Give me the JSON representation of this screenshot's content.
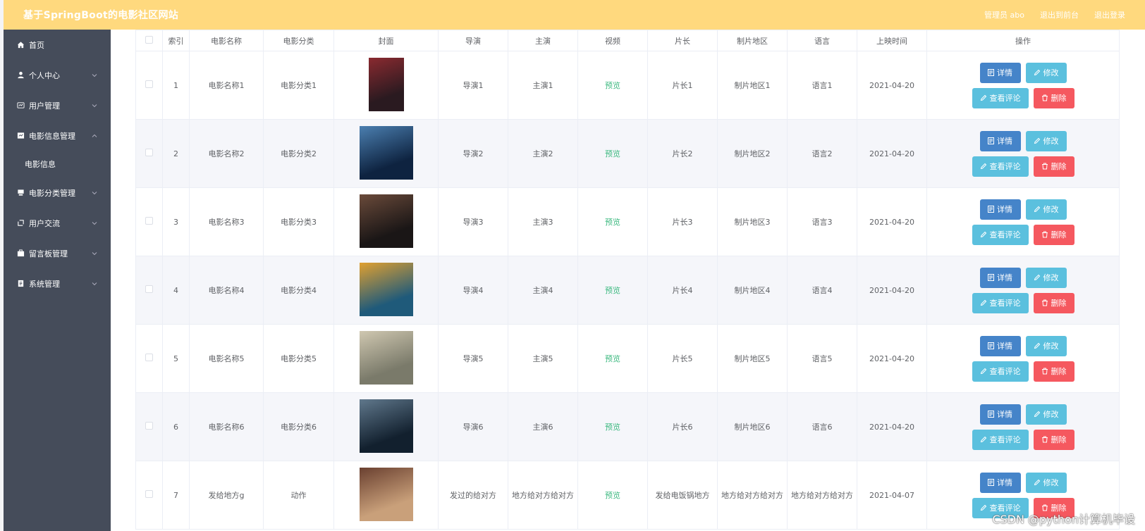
{
  "header": {
    "title": "基于SpringBoot的电影社区网站",
    "admin_label": "管理员 abo",
    "back_label": "退出到前台",
    "logout_label": "退出登录"
  },
  "sidebar": {
    "items": [
      {
        "label": "首页",
        "icon": "home-icon"
      },
      {
        "label": "个人中心",
        "icon": "user-icon"
      },
      {
        "label": "用户管理",
        "icon": "users-icon"
      },
      {
        "label": "电影信息管理",
        "icon": "film-icon"
      },
      {
        "label": "电影信息",
        "sub": true
      },
      {
        "label": "电影分类管理",
        "icon": "category-icon"
      },
      {
        "label": "用户交流",
        "icon": "chat-icon"
      },
      {
        "label": "留言板管理",
        "icon": "message-icon"
      },
      {
        "label": "系统管理",
        "icon": "settings-icon"
      }
    ]
  },
  "table": {
    "headers": [
      "索引",
      "电影名称",
      "电影分类",
      "封面",
      "导演",
      "主演",
      "视频",
      "片长",
      "制片地区",
      "语言",
      "上映时间",
      "操作"
    ],
    "preview_label": "预览",
    "buttons": {
      "detail": "详情",
      "edit": "修改",
      "comment": "查看评论",
      "delete": "删除"
    },
    "rows": [
      {
        "index": "1",
        "name": "电影名称1",
        "category": "电影分类1",
        "director": "导演1",
        "actor": "主演1",
        "length": "片长1",
        "region": "制片地区1",
        "language": "语言1",
        "date": "2021-04-20"
      },
      {
        "index": "2",
        "name": "电影名称2",
        "category": "电影分类2",
        "director": "导演2",
        "actor": "主演2",
        "length": "片长2",
        "region": "制片地区2",
        "language": "语言2",
        "date": "2021-04-20"
      },
      {
        "index": "3",
        "name": "电影名称3",
        "category": "电影分类3",
        "director": "导演3",
        "actor": "主演3",
        "length": "片长3",
        "region": "制片地区3",
        "language": "语言3",
        "date": "2021-04-20"
      },
      {
        "index": "4",
        "name": "电影名称4",
        "category": "电影分类4",
        "director": "导演4",
        "actor": "主演4",
        "length": "片长4",
        "region": "制片地区4",
        "language": "语言4",
        "date": "2021-04-20"
      },
      {
        "index": "5",
        "name": "电影名称5",
        "category": "电影分类5",
        "director": "导演5",
        "actor": "主演5",
        "length": "片长5",
        "region": "制片地区5",
        "language": "语言5",
        "date": "2021-04-20"
      },
      {
        "index": "6",
        "name": "电影名称6",
        "category": "电影分类6",
        "director": "导演6",
        "actor": "主演6",
        "length": "片长6",
        "region": "制片地区6",
        "language": "语言6",
        "date": "2021-04-20"
      },
      {
        "index": "7",
        "name": "发给地方g",
        "category": "动作",
        "director": "发过的给对方",
        "actor": "地方给对方给对方",
        "length": "发给电饭锅地方",
        "region": "地方给对方给对方",
        "language": "地方给对方给对方",
        "date": "2021-04-07"
      }
    ]
  },
  "colors": {
    "header": "#ffd97e",
    "sidebar": "#454c5a",
    "detail": "#4584c9",
    "edit": "#5bc0de",
    "delete": "#f5585f",
    "preview": "#3db980"
  },
  "watermark": "CSDN @python计算机毕设"
}
